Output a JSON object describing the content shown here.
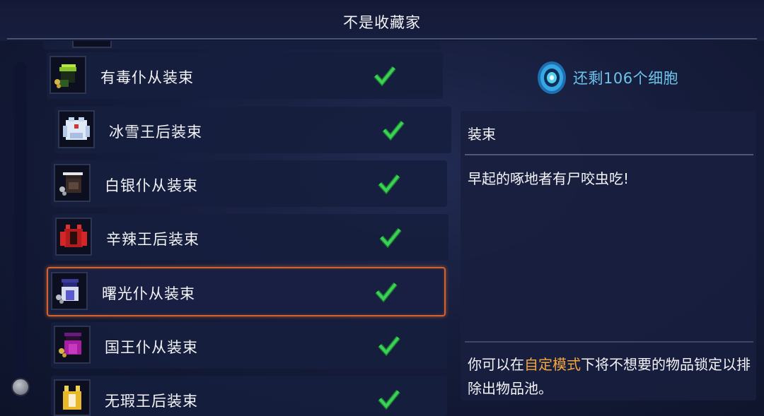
{
  "header": {
    "title": "不是收藏家"
  },
  "list": {
    "items": [
      {
        "label": "有毒仆从装束",
        "icon": "toxic-servant-outfit-icon",
        "unlocked": true
      },
      {
        "label": "冰雪王后装束",
        "icon": "ice-queen-outfit-icon",
        "unlocked": true
      },
      {
        "label": "白银仆从装束",
        "icon": "silver-servant-outfit-icon",
        "unlocked": true
      },
      {
        "label": "辛辣王后装束",
        "icon": "spicy-queen-outfit-icon",
        "unlocked": true
      },
      {
        "label": "曙光仆从装束",
        "icon": "dawn-servant-outfit-icon",
        "unlocked": true,
        "selected": true
      },
      {
        "label": "国王仆从装束",
        "icon": "king-servant-outfit-icon",
        "unlocked": true
      },
      {
        "label": "无瑕王后装束",
        "icon": "flawless-queen-outfit-icon",
        "unlocked": true
      }
    ]
  },
  "cells": {
    "text": "还剩106个细胞",
    "icon": "cell-icon"
  },
  "detail": {
    "category": "装束",
    "description": "早起的啄地者有尸咬虫吃!",
    "note_prefix": "你可以在",
    "note_link": "自定模式",
    "note_suffix": "下将不想要的物品锁定以排除出物品池。"
  },
  "colors": {
    "selection_border": "#d4622a",
    "check_green": "#3bd056",
    "cells_text": "#6cc4ea",
    "highlight": "#f2a640"
  }
}
